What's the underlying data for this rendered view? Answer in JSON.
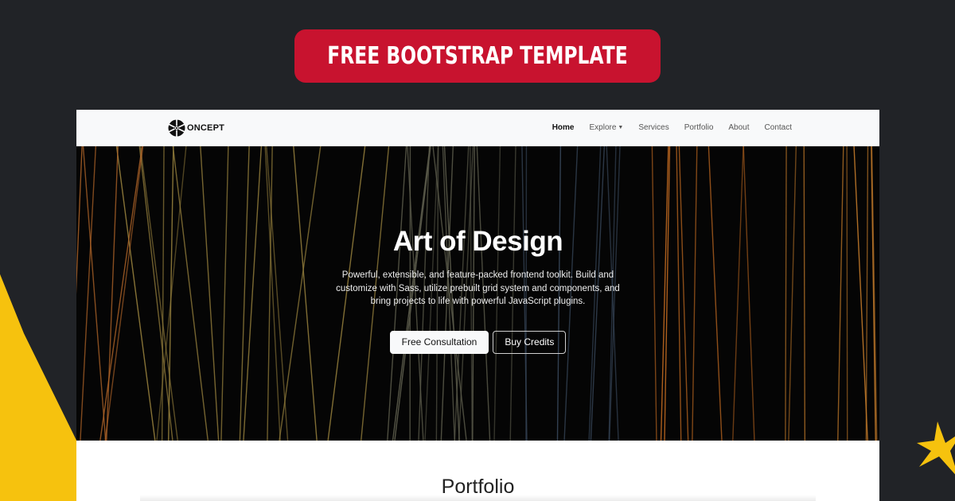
{
  "banner": {
    "label": "FREE BOOTSTRAP TEMPLATE"
  },
  "navbar": {
    "brand": "ONCEPT",
    "links": [
      {
        "label": "Home",
        "active": true
      },
      {
        "label": "Explore",
        "dropdown": true
      },
      {
        "label": "Services"
      },
      {
        "label": "Portfolio"
      },
      {
        "label": "About"
      },
      {
        "label": "Contact"
      }
    ]
  },
  "hero": {
    "title": "Art of Design",
    "description": "Powerful, extensible, and feature-packed frontend toolkit. Build and customize with Sass, utilize prebuilt grid system and components, and bring projects to life with powerful JavaScript plugins.",
    "primary_button": "Free Consultation",
    "secondary_button": "Buy Credits"
  },
  "section": {
    "title": "Portfolio"
  },
  "colors": {
    "background": "#212327",
    "banner": "#c8132f",
    "accent_yellow": "#f6c20e",
    "navbar": "#f8f9fa",
    "hero": "#050505"
  },
  "icons": {
    "logo": "film-reel-icon",
    "dropdown": "caret-down-icon",
    "decoration": "star-icon"
  }
}
